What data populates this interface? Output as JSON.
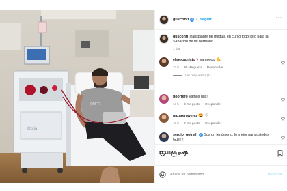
{
  "post": {
    "username": "gusconti",
    "follow_label": "Seguir",
    "more_icon": "ellipsis-icon",
    "caption_text": "Transplante de médula en curso todo listo para la Sanacion de mi hermano",
    "caption_time": "1 día"
  },
  "comments": [
    {
      "username": "elmecapristo",
      "text": "Vamoooo",
      "age": "22 h",
      "likes": "80 Me gusta",
      "reply": "Responder",
      "view_replies": "Ver respuestas (1)"
    },
    {
      "username": "floortero",
      "text": "Vamos gus!!",
      "age": "13 h",
      "likes": "6 Me gusta",
      "reply": "Responder"
    },
    {
      "username": "nazarenavelez",
      "text": "",
      "age": "16 h",
      "likes": "7 Me gusta",
      "reply": "Responder"
    },
    {
      "username": "sergio_goinal",
      "text": "Sos un fenómeno, lo mejor para ustedes Gus !!!",
      "age": "",
      "likes": "",
      "reply": ""
    }
  ],
  "actions": {
    "likes_count": "31,183 Me gusta",
    "date": "",
    "icons": [
      "heart-icon",
      "comment-icon",
      "share-icon",
      "bookmark-icon"
    ]
  },
  "composer": {
    "placeholder": "Añade un comentario...",
    "publish_label": "Publicar"
  },
  "colors": {
    "link_blue": "#0095f6",
    "meta_gray": "#8e8e8e",
    "like_red": "#ed4956"
  }
}
